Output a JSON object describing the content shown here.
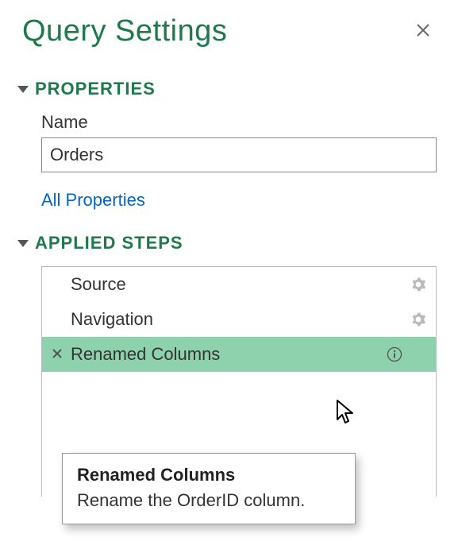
{
  "panel": {
    "title": "Query Settings"
  },
  "sections": {
    "properties": {
      "heading": "PROPERTIES",
      "name_label": "Name",
      "name_value": "Orders",
      "all_properties_link": "All Properties"
    },
    "applied_steps": {
      "heading": "APPLIED STEPS",
      "steps": [
        {
          "label": "Source",
          "has_settings": true,
          "selected": false
        },
        {
          "label": "Navigation",
          "has_settings": true,
          "selected": false
        },
        {
          "label": "Renamed Columns",
          "has_settings": false,
          "selected": true,
          "has_info": true
        }
      ]
    }
  },
  "tooltip": {
    "title": "Renamed Columns",
    "description": "Rename the OrderID column."
  }
}
